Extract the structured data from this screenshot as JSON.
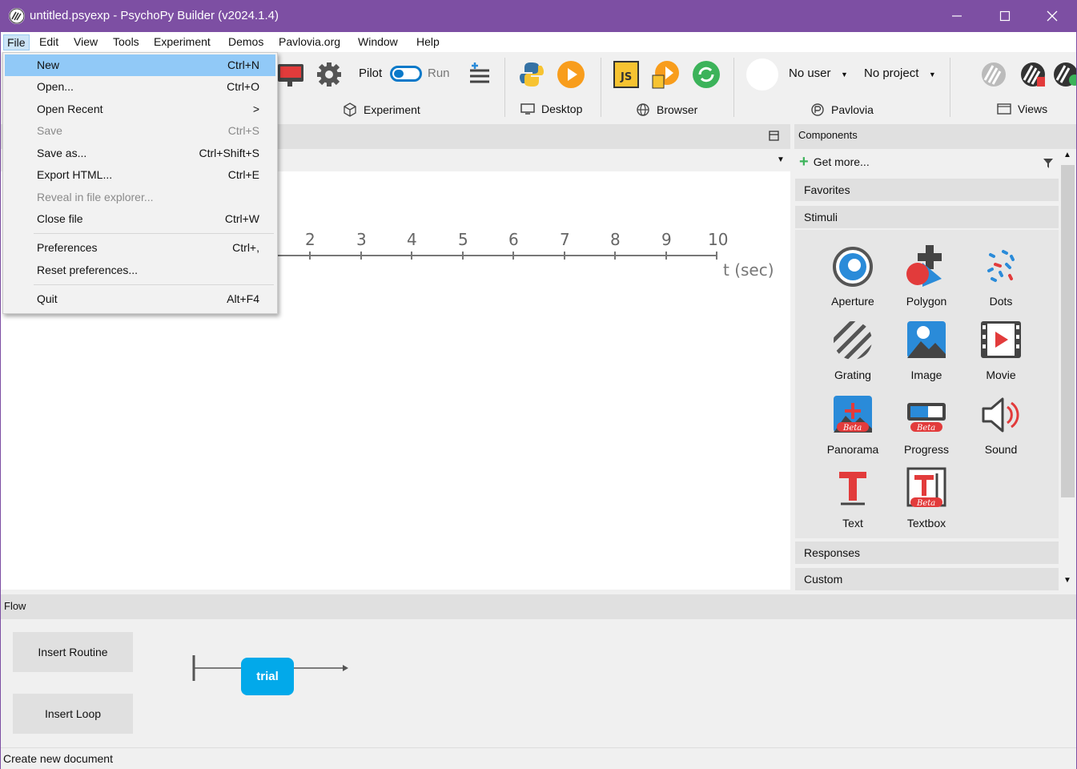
{
  "window": {
    "title": "untitled.psyexp - PsychoPy Builder (v2024.1.4)",
    "accent": "#7d4fa3"
  },
  "menubar": {
    "items": [
      {
        "label": "File"
      },
      {
        "label": "Edit"
      },
      {
        "label": "View"
      },
      {
        "label": "Tools"
      },
      {
        "label": "Experiment"
      },
      {
        "label": "Demos"
      },
      {
        "label": "Pavlovia.org"
      },
      {
        "label": "Window"
      },
      {
        "label": "Help"
      }
    ]
  },
  "toolbar": {
    "pilot_label": "Pilot",
    "run_label": "Run",
    "experiment_label": "Experiment",
    "desktop_label": "Desktop",
    "browser_label": "Browser",
    "user_label": "No user",
    "project_label": "No project",
    "pavlovia_label": "Pavlovia",
    "views_label": "Views"
  },
  "file_menu": {
    "items": [
      {
        "label": "New",
        "shortcut": "Ctrl+N"
      },
      {
        "label": "Open...",
        "shortcut": "Ctrl+O"
      },
      {
        "label": "Open Recent",
        "shortcut": ">"
      },
      {
        "label": "Save",
        "shortcut": "Ctrl+S"
      },
      {
        "label": "Save as...",
        "shortcut": "Ctrl+Shift+S"
      },
      {
        "label": "Export HTML...",
        "shortcut": "Ctrl+E"
      },
      {
        "label": "Reveal in file explorer...",
        "shortcut": ""
      },
      {
        "label": "Close file",
        "shortcut": "Ctrl+W"
      },
      {
        "label": "Preferences",
        "shortcut": "Ctrl+,"
      },
      {
        "label": "Reset preferences...",
        "shortcut": ""
      },
      {
        "label": "Quit",
        "shortcut": "Alt+F4"
      }
    ]
  },
  "timeline": {
    "ticks": [
      "2",
      "3",
      "4",
      "5",
      "6",
      "7",
      "8",
      "9",
      "10"
    ],
    "unit_label": "t (sec)"
  },
  "components": {
    "header": "Components",
    "get_more": "Get more...",
    "categories": {
      "favorites": "Favorites",
      "stimuli": "Stimuli",
      "responses": "Responses",
      "custom": "Custom"
    },
    "stimuli": [
      {
        "label": "Aperture"
      },
      {
        "label": "Polygon"
      },
      {
        "label": "Dots"
      },
      {
        "label": "Grating"
      },
      {
        "label": "Image"
      },
      {
        "label": "Movie"
      },
      {
        "label": "Panorama"
      },
      {
        "label": "Progress"
      },
      {
        "label": "Sound"
      },
      {
        "label": "Text"
      },
      {
        "label": "Textbox"
      }
    ],
    "beta_badge": "Beta"
  },
  "flow": {
    "header": "Flow",
    "insert_routine": "Insert Routine",
    "insert_loop": "Insert Loop",
    "routine_name": "trial"
  },
  "statusbar": {
    "text": "Create new document"
  }
}
